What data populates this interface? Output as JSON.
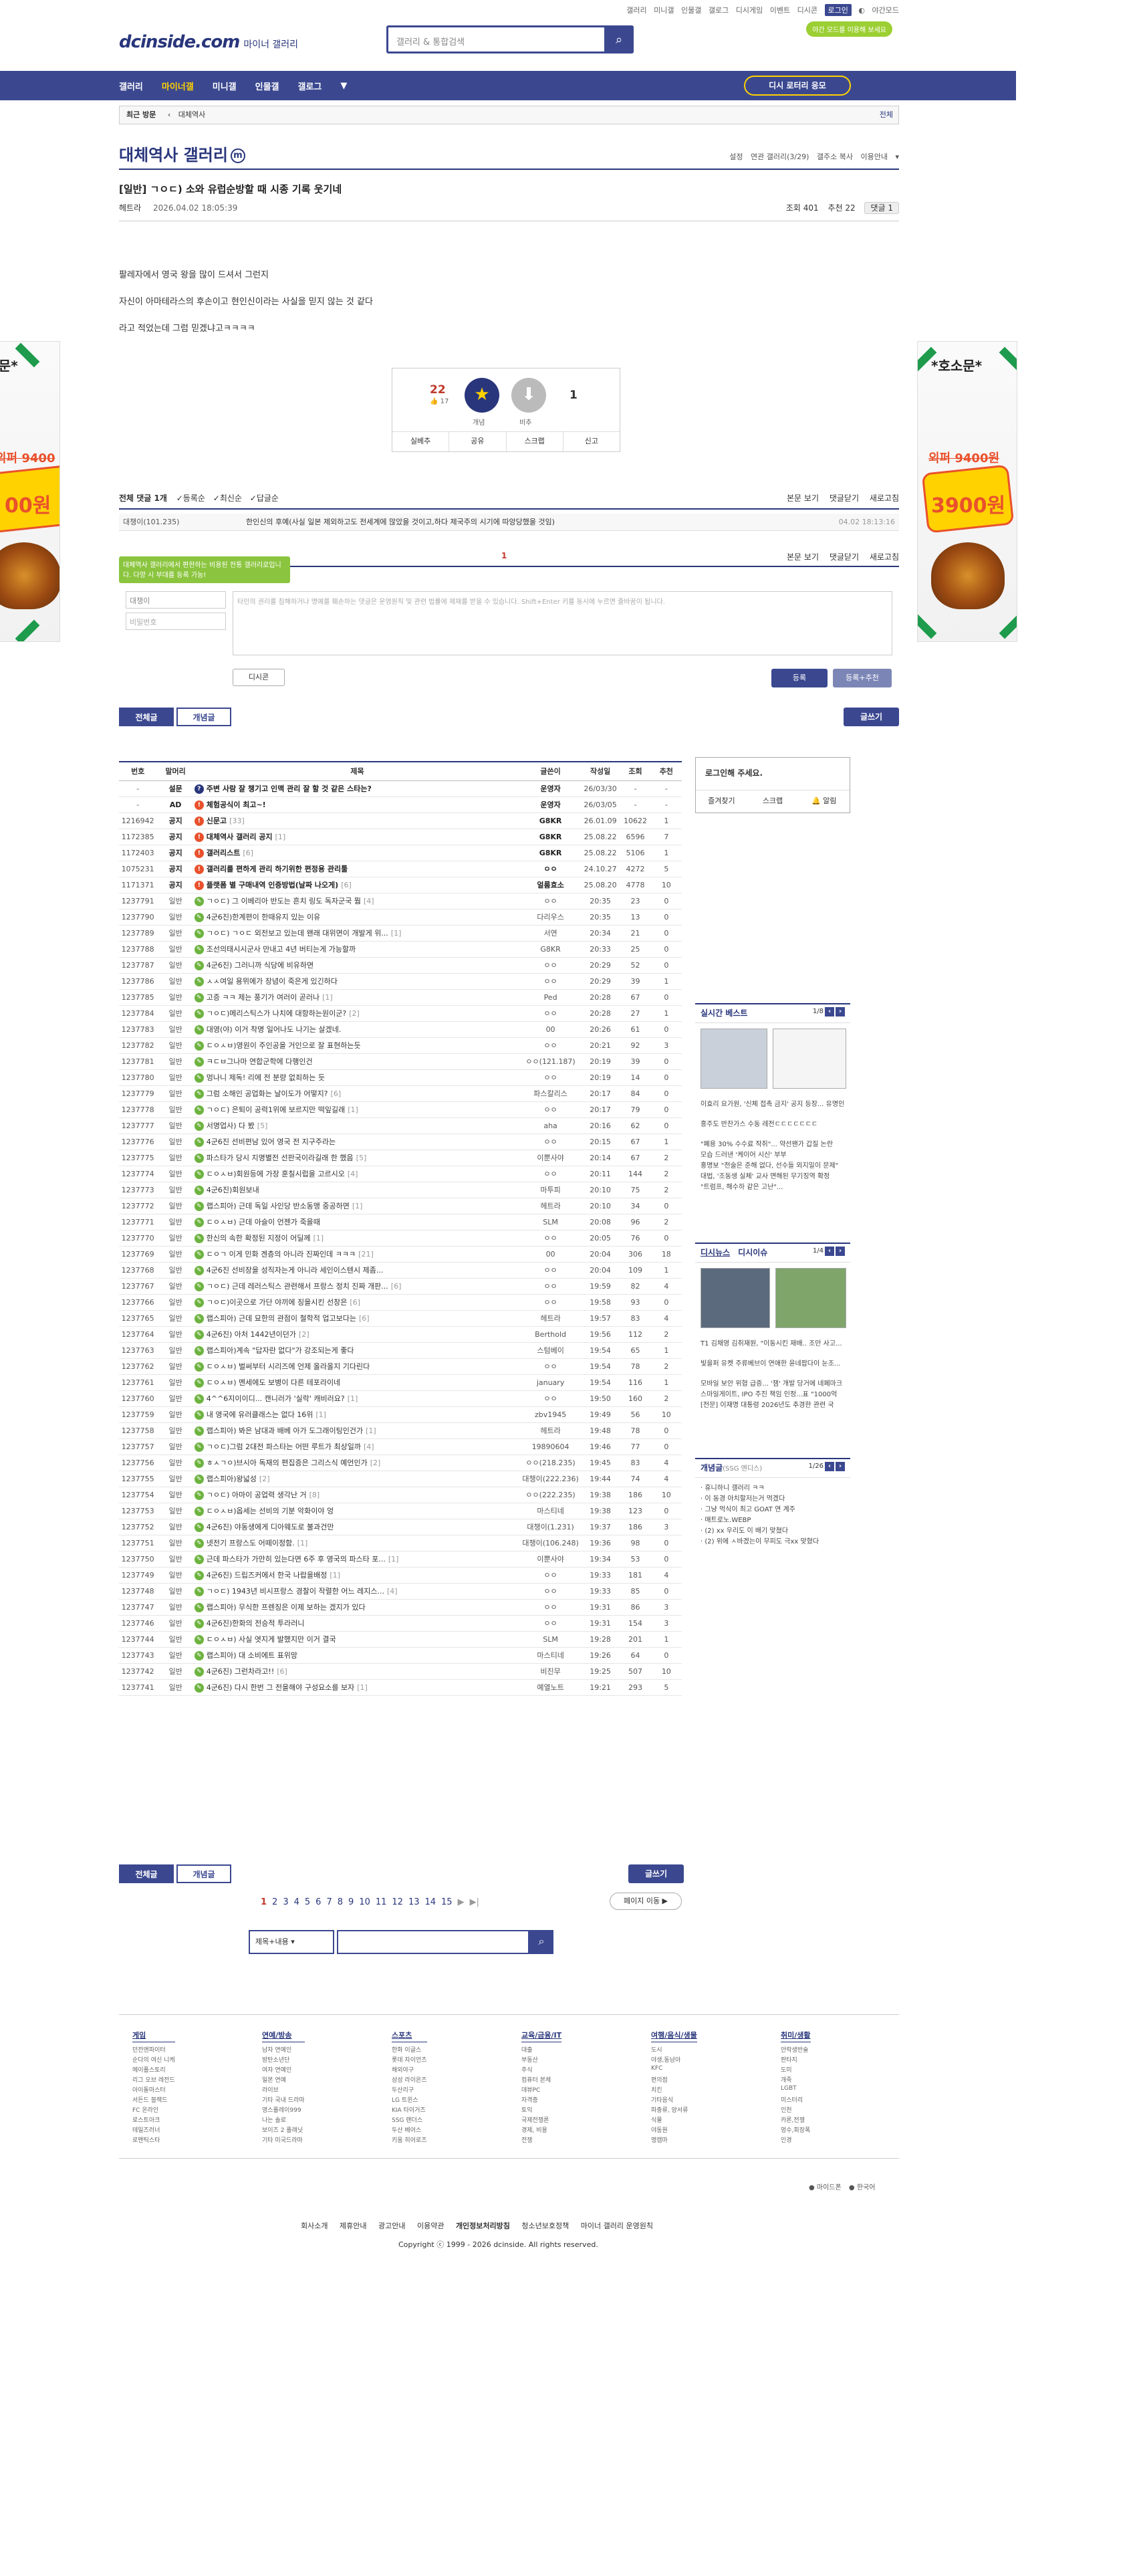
{
  "topmenu": [
    "갤러리",
    "미니갤",
    "인물갤",
    "갤로그",
    "디시게임",
    "이벤트",
    "디시콘",
    "로그인",
    "야간모드"
  ],
  "logo": "dcinside.com",
  "logo_sub": "마이너 갤러리",
  "search_placeholder": "갤러리 & 통합검색",
  "dark_mode_btn": "야간 모드를 이용해 보세요",
  "gnb": [
    "갤러리",
    "마이너갤",
    "미니갤",
    "인물갤",
    "갤로그",
    "▼"
  ],
  "revisit": "디시 로터리 응모",
  "visit_label": "최근 방문",
  "visit_item": "대체역사",
  "visit_all": "전체",
  "gallery_title": "대체역사 갤러리",
  "gallery_badge": "m",
  "gmenu": [
    "설정",
    "연관 갤러리(3/29)",
    "갤주소 복사",
    "이용안내",
    "▾"
  ],
  "post": {
    "title": "[일반] ㄱㅇㄷ) 소와 유럽순방할 때 시종 기록 웃기네",
    "author": "헤트라",
    "date": "2026.04.02 18:05:39",
    "views": "조회 401",
    "recs": "추천 22",
    "comments": "댓글 1",
    "lines": [
      "팔레자에서 영국 왕을 많이 드셔서 그런지",
      "자신이 아마테라스의 후손이고 현인신이라는 사실을 믿지 않는 것 같다",
      "라고 적었는데 그럼 믿겠냐고ㅋㅋㅋㅋ"
    ]
  },
  "rec": {
    "up": "22",
    "fix": "17",
    "down": "1",
    "up_label": "개념",
    "down_label": "비추",
    "bar": [
      "실베추",
      "공유",
      "스크랩",
      "신고"
    ]
  },
  "cmt": {
    "head_left": "전체 댓글 1개",
    "sort": [
      "등록순",
      "최신순",
      "답글순"
    ],
    "head_right": [
      "본문 보기",
      "댓글닫기",
      "새로고침"
    ],
    "row": {
      "nick": "대챙이(101.235)",
      "text": "한인신의 후예(사실 일본 제외하고도 전세계에 많았을 것이고,하다 제국주의 시기에 따앙당했을 것임)",
      "date": "04.02 18:13:16"
    },
    "count": "1",
    "tip": "대체역사 갤러리에서 편한하는 비용된 전통 갤러리로입니다. 다양 시 부대를 등록 가능!",
    "nick_ph": "대챙이",
    "pw_ph": "비밀번호",
    "textarea_ph": "타인의 권리를 침해하거나 명예를 훼손하는 댓글은 운영원칙 및 관련 법률에 제재를 받을 수 있습니다. Shift+Enter 키를 동시에 누르면 줄바꿈이 됩니다.",
    "dccon": "디시콘",
    "submit": "등록",
    "submit2": "등록+추천"
  },
  "tabs": [
    "전체글",
    "개념글"
  ],
  "write": "글쓰기",
  "cols": [
    "번호",
    "말머리",
    "제목",
    "글쓴이",
    "작성일",
    "조회",
    "추천"
  ],
  "rows": [
    [
      "-",
      "설문",
      "주변 사람 잘 챙기고 인맥 관리 잘 할 것 같은 스타는?",
      "",
      "운영자",
      "26/03/30",
      "-",
      "-",
      "q",
      "1"
    ],
    [
      "-",
      "AD",
      "체험공식이 최고~!",
      "",
      "운영자",
      "26/03/05",
      "-",
      "-",
      "n",
      "1"
    ],
    [
      "1216942",
      "공지",
      "신문고",
      "[33]",
      "G8KR",
      "26.01.09",
      "10622",
      "1",
      "n",
      "1"
    ],
    [
      "1172385",
      "공지",
      "대체역사 갤러리 공지",
      "[1]",
      "G8KR",
      "25.08.22",
      "6596",
      "7",
      "n",
      "1"
    ],
    [
      "1172403",
      "공지",
      "갤러리스트",
      "[6]",
      "G8KR",
      "25.08.22",
      "5106",
      "1",
      "n",
      "1"
    ],
    [
      "1075231",
      "공지",
      "갤러리를 편하게 관리 하기위한 편정용 관리툴",
      "",
      "ㅇㅇ",
      "24.10.27",
      "4272",
      "5",
      "n",
      "1"
    ],
    [
      "1171371",
      "공지",
      "플랫폼 별 구매내역 인증방법(날짜 나오게)",
      "[6]",
      "얼룸효소",
      "25.08.20",
      "4778",
      "10",
      "n",
      "1"
    ],
    [
      "1237791",
      "일반",
      "ㄱㅇㄷ) 그 이베리아 반도는 흔치 링도 독자군국 뭠",
      "[4]",
      "ㅇㅇ",
      "20:35",
      "23",
      "0",
      "g",
      "0"
    ],
    [
      "1237790",
      "일반",
      "4군6진)한계편이 한때유지 있는 이유",
      "",
      "다리우스",
      "20:35",
      "13",
      "0",
      "g",
      "0"
    ],
    [
      "1237789",
      "일반",
      "ㄱㅇㄷ) ㄱㅇㄷ 외전보고 있는데 왠래 대위면이 개발게 위...",
      "[1]",
      "서연",
      "20:34",
      "21",
      "0",
      "g",
      "0"
    ],
    [
      "1237788",
      "일반",
      "조선의태시시군사 만내고 4년 버티는게 가능할까",
      "",
      "G8KR",
      "20:33",
      "25",
      "0",
      "g",
      "0"
    ],
    [
      "1237787",
      "일반",
      "4군6진) 그러니까 식당에 비유하면",
      "",
      "ㅇㅇ",
      "20:29",
      "52",
      "0",
      "g",
      "0"
    ],
    [
      "1237786",
      "일반",
      "ㅅㅅ여일 용뮈에가 장념이 죽은게 있긴하다",
      "",
      "ㅇㅇ",
      "20:29",
      "39",
      "1",
      "g",
      "0"
    ],
    [
      "1237785",
      "일반",
      "고증 ㅋㅋ 제는 풍기가 여러이 곧러나",
      "[1]",
      "Ped",
      "20:28",
      "67",
      "0",
      "g",
      "0"
    ],
    [
      "1237784",
      "일반",
      "ㄱㅇㄷ)메리스틱스가 나치에 대항하는원이군?",
      "[2]",
      "ㅇㅇ",
      "20:28",
      "27",
      "1",
      "g",
      "0"
    ],
    [
      "1237783",
      "일반",
      "대영(야) 이거 착명 일어나도 나기는 살겠네.",
      "",
      "00",
      "20:26",
      "61",
      "0",
      "g",
      "0"
    ],
    [
      "1237782",
      "일반",
      "ㄷㅇㅅㅂ)영원이 주인공을 거인으로 잘 표현하는듯",
      "",
      "ㅇㅇ",
      "20:21",
      "92",
      "3",
      "g",
      "0"
    ],
    [
      "1237781",
      "일반",
      "ㅋㄷㅂ그나마 연합군학에 다행인건",
      "",
      "ㅇㅇ(121.187)",
      "20:19",
      "39",
      "0",
      "g",
      "0"
    ],
    [
      "1237780",
      "일반",
      "멍나니 제독! 리에 전 분량 없죄하는 듯",
      "",
      "ㅇㅇ",
      "20:19",
      "14",
      "0",
      "g",
      "0"
    ],
    [
      "1237779",
      "일반",
      "그럼 소해인 공업화는 날이도가 어떻지?",
      "[6]",
      "파스칼리스",
      "20:17",
      "84",
      "0",
      "g",
      "0"
    ],
    [
      "1237778",
      "일반",
      "ㄱㅇㄷ) 은퇴이 공력1위에 보르지만 떡잎길래",
      "[1]",
      "ㅇㅇ",
      "20:17",
      "79",
      "0",
      "g",
      "0"
    ],
    [
      "1237777",
      "일반",
      "서명업사) 다 봤",
      "[5]",
      "aha",
      "20:16",
      "62",
      "0",
      "g",
      "0"
    ],
    [
      "1237776",
      "일반",
      "4군6진 선비편남 있어 영국 전 지구주라는",
      "",
      "ㅇㅇ",
      "20:15",
      "67",
      "1",
      "g",
      "0"
    ],
    [
      "1237775",
      "일반",
      "파스타가 당시 지명별전 선판국이라길래 한 했음",
      "[5]",
      "이뿐사야",
      "20:14",
      "67",
      "2",
      "g",
      "0"
    ],
    [
      "1237774",
      "일반",
      "ㄷㅇㅅㅂ)회원등에 가장 훈칠시럽을 고르시오",
      "[4]",
      "ㅇㅇ",
      "20:11",
      "144",
      "2",
      "g",
      "0"
    ],
    [
      "1237773",
      "일반",
      "4군6진)회원보내",
      "",
      "마투피",
      "20:10",
      "75",
      "2",
      "g",
      "0"
    ],
    [
      "1237772",
      "일반",
      "랩스피아) 근데 독일 사인당 반소동맹 중공하면",
      "[1]",
      "헤트라",
      "20:10",
      "34",
      "0",
      "g",
      "0"
    ],
    [
      "1237771",
      "일반",
      "ㄷㅇㅅㅂ) 근데 아슬이 언젠가 죽을때",
      "",
      "SLM",
      "20:08",
      "96",
      "2",
      "g",
      "0"
    ],
    [
      "1237770",
      "일반",
      "한신의 속한 확정된 지정이 어딜께",
      "[1]",
      "ㅇㅇ",
      "20:05",
      "76",
      "0",
      "g",
      "0"
    ],
    [
      "1237769",
      "일반",
      "ㄷㅇㄱ 이게 민화 겐층의 아니라 진짜인데 ㅋㅋㅋ",
      "[21]",
      "00",
      "20:04",
      "306",
      "18",
      "g",
      "0"
    ],
    [
      "1237768",
      "일반",
      "4군6진 선비장을 성직자는게 아니라 세인이스텐시 제좀...",
      "",
      "ㅇㅇ",
      "20:04",
      "109",
      "1",
      "g",
      "0"
    ],
    [
      "1237767",
      "일반",
      "ㄱㅇㄷ) 근데 레러스틱스 관련해서 프랑스 정치 진짜 개판...",
      "[6]",
      "ㅇㅇ",
      "19:59",
      "82",
      "4",
      "g",
      "0"
    ],
    [
      "1237766",
      "일반",
      "ㄱㅇㄷ)이곳으로 가단 야끼에 징을시킨 선창은",
      "[6]",
      "ㅇㅇ",
      "19:58",
      "93",
      "0",
      "g",
      "0"
    ],
    [
      "1237765",
      "일반",
      "랩스피아) 근데 묘한의 관점이 철학적 업고보다는",
      "[6]",
      "헤트라",
      "19:57",
      "83",
      "4",
      "g",
      "0"
    ],
    [
      "1237764",
      "일반",
      "4군6진) 아처 1442년이던가",
      "[2]",
      "Berthold",
      "19:56",
      "112",
      "2",
      "g",
      "0"
    ],
    [
      "1237763",
      "일반",
      "랩스피아)계속 \"답자란 없다\"가 강조되는게 좋다",
      "",
      "스텀베이",
      "19:54",
      "65",
      "1",
      "g",
      "0"
    ],
    [
      "1237762",
      "일반",
      "ㄷㅇㅅㅂ) 벌써부터 시리즈에 언제 올라올지 기다린다",
      "",
      "ㅇㅇ",
      "19:54",
      "78",
      "2",
      "g",
      "0"
    ],
    [
      "1237761",
      "일반",
      "ㄷㅇㅅㅂ) 멘세에도 보병이 다른 테포라이네",
      "",
      "january",
      "19:54",
      "116",
      "1",
      "g",
      "0"
    ],
    [
      "1237760",
      "일반",
      "4^^6지이이디... 캔니러가 '실락' 캐비러요?",
      "[1]",
      "ㅇㅇ",
      "19:50",
      "160",
      "2",
      "g",
      "0"
    ],
    [
      "1237759",
      "일반",
      "내 영국에 유러클래스는 없다 16위",
      "[1]",
      "zbv1945",
      "19:49",
      "56",
      "10",
      "g",
      "0"
    ],
    [
      "1237758",
      "일반",
      "랩스피아) 봐은 남대과 배베 아가 도그래이팅인건가",
      "[1]",
      "헤트라",
      "19:48",
      "78",
      "0",
      "g",
      "0"
    ],
    [
      "1237757",
      "일반",
      "ㄱㅇㄷ)그럼 2대전 파스타는 어떤 루트가 최상일까",
      "[4]",
      "19890604",
      "19:46",
      "77",
      "0",
      "g",
      "0"
    ],
    [
      "1237756",
      "일반",
      "ㅎㅅㄱㅇ)브시아 독재의 편집증은 그리스식 예언인가",
      "[2]",
      "ㅇㅇ(218.235)",
      "19:45",
      "83",
      "4",
      "g",
      "0"
    ],
    [
      "1237755",
      "일반",
      "랩스피아)왕넓성",
      "[2]",
      "대챙이(222.236)",
      "19:44",
      "74",
      "4",
      "g",
      "0"
    ],
    [
      "1237754",
      "일반",
      "ㄱㅇㄷ) 아마이 공업력 생각난 거",
      "[8]",
      "ㅇㅇ(222.235)",
      "19:38",
      "186",
      "10",
      "g",
      "0"
    ],
    [
      "1237753",
      "일반",
      "ㄷㅇㅅㅂ)옵세는 선비의 기분 악화이야 엉",
      "",
      "마스티네",
      "19:38",
      "123",
      "0",
      "g",
      "0"
    ],
    [
      "1237752",
      "일반",
      "4군6진) 야동생에게 디아웨도로 불과건만",
      "",
      "대챙이(1.231)",
      "19:37",
      "186",
      "3",
      "g",
      "0"
    ],
    [
      "1237751",
      "일반",
      "넷전기 프랑스도 어떼이정함.",
      "[1]",
      "대챙이(106.248)",
      "19:36",
      "98",
      "0",
      "g",
      "0"
    ],
    [
      "1237750",
      "일반",
      "근데 파스타가 가만히 있는다면 6주 후 영국의 파스타 포...",
      "[1]",
      "이뿐사야",
      "19:34",
      "53",
      "0",
      "g",
      "0"
    ],
    [
      "1237749",
      "일반",
      "4군6진) 드립즈커에서 한국 나랍을배정",
      "[1]",
      "ㅇㅇ",
      "19:33",
      "181",
      "4",
      "g",
      "0"
    ],
    [
      "1237748",
      "일반",
      "ㄱㅇㄷ) 1943년 비시프랑스 경찰이 작렬한 어느 레지스...",
      "[4]",
      "ㅇㅇ",
      "19:33",
      "85",
      "0",
      "g",
      "0"
    ],
    [
      "1237747",
      "일반",
      "랩스피아) 무식한 프렌징은 이제 보하는 겠지가 있다",
      "",
      "ㅇㅇ",
      "19:31",
      "86",
      "3",
      "g",
      "0"
    ],
    [
      "1237746",
      "일반",
      "4군6진)한화의 전승적 투라러니",
      "",
      "ㅇㅇ",
      "19:31",
      "154",
      "3",
      "g",
      "0"
    ],
    [
      "1237744",
      "일반",
      "ㄷㅇㅅㅂ) 사실 엿지게 발했지만 이거 결국",
      "",
      "SLM",
      "19:28",
      "201",
      "1",
      "g",
      "0"
    ],
    [
      "1237743",
      "일반",
      "랩스피아) 대 소비에트 표위망",
      "",
      "마스티네",
      "19:26",
      "64",
      "0",
      "g",
      "0"
    ],
    [
      "1237742",
      "일반",
      "4군6진) 그런차라고!!",
      "[6]",
      "비진무",
      "19:25",
      "507",
      "10",
      "g",
      "0"
    ],
    [
      "1237741",
      "일반",
      "4군6진) 다시 한번 그 전을해야 구성요소를 보자",
      "[1]",
      "예열노트",
      "19:21",
      "293",
      "5",
      "g",
      "0"
    ]
  ],
  "login_box": {
    "title": "로그인해 주세요.",
    "btns": [
      "즐겨찾기",
      "스크랩",
      "알림"
    ]
  },
  "realtime": {
    "title": "실시간 베스트",
    "page": "1/8",
    "items": [
      "이효리 요가원, '신체 접촉 금지' 공지 등장... 유명인",
      "흥주도 반찬가스 수동 레전ㄷㄷㄷㄷㄷㄷㄷ",
      "\"폐용 30% 수수료 작취\"... 약선왠가 갑질 논란",
      "모습 드러낸 '케이어 시신' 부부",
      "홍명보 \"전술은 준해 없다, 선수들 외지밀이 문제\"",
      "대법, '조동생 실체' 교사 면해된 무기징역 확정",
      "\"트럼프, 해수하 같은 고난\"..."
    ]
  },
  "disc": {
    "title": "디시뉴스",
    "title2": "디시이슈",
    "page": "1/4",
    "items": [
      "T1 김채영 김취재원, \"이동시킨 재배.. 조만 사고...",
      "빛을퍼 유켓 주류베브이 연애한 윤네팝다이 눈조...",
      "모바일 보안 위협 급증... '잼' 개발 당거에 네페마크러",
      "스마일게이트, IPO 주진 책임 인정...표 \"1000억원...",
      "[전문] 이재명 대통령 2026년도 추경한 관련 국회..."
    ]
  },
  "concept": {
    "title": "개념글",
    "sub": "(SSG 엔디스)",
    "page": "1/26",
    "items": [
      "휴니하니 갤러리 ㅋㅋ",
      "이 동경 아치할저는거 먹겠다",
      "그냥 먹식이 최고 GOAT 연 계주",
      "매트로노.WEBP",
      "(2) xx 우리도 이 배기 맞쳤다",
      "(2) 위에 ㅅ바겠는이 무피도 극xx 맞혔다"
    ]
  },
  "pager": [
    "1",
    "2",
    "3",
    "4",
    "5",
    "6",
    "7",
    "8",
    "9",
    "10",
    "11",
    "12",
    "13",
    "14",
    "15",
    "▶",
    "▶|"
  ],
  "pagemove": "페이지 이동 ▶",
  "bsearch": {
    "sel": "제목+내용",
    "btn": "⌕"
  },
  "footer_cols": [
    {
      "t": "게임",
      "i": [
        "던전앤파이터",
        "순다의 여신 니케",
        "메이플스토리",
        "리그 오브 레전드",
        "아이돌마스터",
        "서든드 블랙드",
        "FC 온라인",
        "로스트아크",
        "테일즈러너",
        "로맨틱스타"
      ]
    },
    {
      "t": "연예/방송",
      "i": [
        "남자 연예인",
        "방탄소년단",
        "여자 연예인",
        "일본 연예",
        "라이브",
        "기타 국내 드라마",
        "영스플레이999",
        "나는 솔로",
        "보이즈 2 플래닛",
        "기타 미국드라마"
      ]
    },
    {
      "t": "스포츠",
      "i": [
        "한화 이글스",
        "롯데 자이언츠",
        "해외야구",
        "삼성 라이온즈",
        "두산리구",
        "LG 트윈스",
        "KIA 타이거즈",
        "SSG 랜더스",
        "두산 베어스",
        "키움 히어로즈"
      ]
    },
    {
      "t": "교육/금융/IT",
      "i": [
        "대출",
        "부동산",
        "주식",
        "컴퓨터 본체",
        "데뷰PC",
        "자격증",
        "토익",
        "국제전쟁론",
        "경제, 비용",
        "전쟁"
      ]
    },
    {
      "t": "여행/음식/생물",
      "i": [
        "도시",
        "야생,동남아",
        "KFC",
        "편의점",
        "치킨",
        "기타음식",
        "파충류, 양서류",
        "식물",
        "야동원",
        "맹캠마"
      ]
    },
    {
      "t": "취미/생활",
      "i": [
        "안락생반술",
        "판타지",
        "도미",
        "개죽",
        "LGBT",
        "미스터리",
        "인천",
        "카론,전쟁",
        "멍수,회장폭",
        "인경"
      ]
    }
  ],
  "footer_right": [
    "마이드폰",
    "한국어"
  ],
  "footer_links": [
    "회사소개",
    "제휴안내",
    "광고안내",
    "이용약관",
    "개인정보처리방침",
    "청소년보호정책",
    "마이너 갤러리 운영원칙"
  ],
  "copyright": "Copyright ⓒ 1999 - 2026 dcinside. All rights reserved.",
  "ad": {
    "head": "*호소문*",
    "old": "외퍼 9400원",
    "price": "3900원",
    "left_price": "00원",
    "left_old": "외퍼 9400"
  }
}
